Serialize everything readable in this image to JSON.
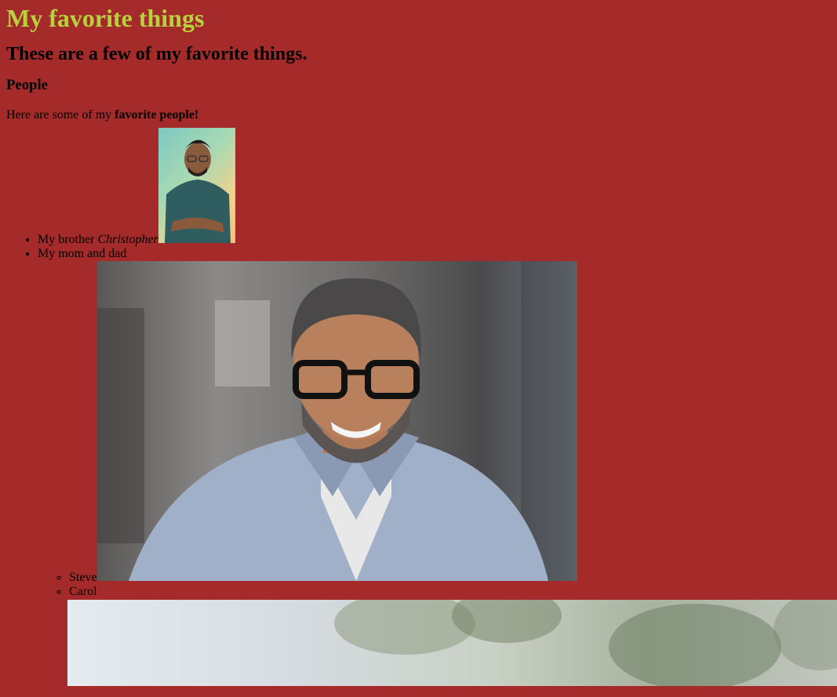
{
  "heading": "My favorite things",
  "subheading": "These are a few of my favorite things.",
  "section_title": "People",
  "intro": {
    "prefix": "Here are some of my ",
    "bold": "favorite people!"
  },
  "people": {
    "brother": {
      "prefix": "My brother ",
      "name": "Christopher",
      "photo_icon": "photo-of-man-in-teal-tshirt"
    },
    "parents": {
      "label": "My mom and dad",
      "children": [
        {
          "label": "Steve",
          "photo_icon": "photo-of-smiling-man-with-glasses"
        },
        {
          "label": "Carol",
          "photo_icon": "photo-of-woman-outdoors"
        }
      ]
    }
  },
  "colors": {
    "background": "#a52a2a",
    "heading": "#b8d13f"
  }
}
